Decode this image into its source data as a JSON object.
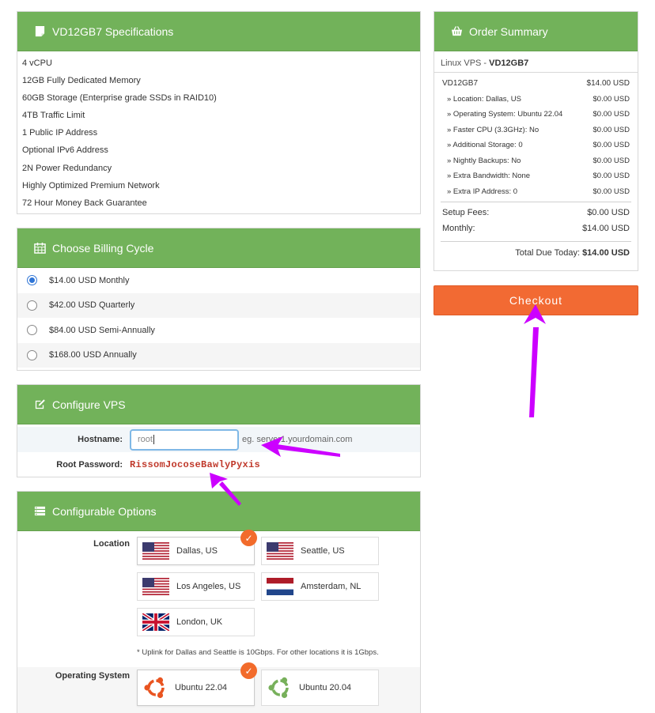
{
  "specs": {
    "title": "VD12GB7 Specifications",
    "items": [
      "4 vCPU",
      "12GB Fully Dedicated Memory",
      "60GB Storage (Enterprise grade SSDs in RAID10)",
      "4TB Traffic Limit",
      "1 Public IP Address",
      "Optional IPv6 Address",
      "2N Power Redundancy",
      "Highly Optimized Premium Network",
      "72 Hour Money Back Guarantee"
    ]
  },
  "billing": {
    "title": "Choose Billing Cycle",
    "options": [
      {
        "label": "$14.00 USD Monthly",
        "selected": true
      },
      {
        "label": "$42.00 USD Quarterly",
        "selected": false
      },
      {
        "label": "$84.00 USD Semi-Annually",
        "selected": false
      },
      {
        "label": "$168.00 USD Annually",
        "selected": false
      }
    ]
  },
  "vps": {
    "title": "Configure VPS",
    "hostname_label": "Hostname:",
    "hostname_value": "root",
    "hostname_hint": "eg. server1.yourdomain.com",
    "password_label": "Root Password:",
    "password_value": "RissomJocoseBawlyPyxis"
  },
  "options": {
    "title": "Configurable Options",
    "location_label": "Location",
    "locations": [
      {
        "name": "Dallas, US",
        "flag": "us",
        "selected": true
      },
      {
        "name": "Seattle, US",
        "flag": "us",
        "selected": false
      },
      {
        "name": "Los Angeles, US",
        "flag": "us",
        "selected": false
      },
      {
        "name": "Amsterdam, NL",
        "flag": "nl",
        "selected": false
      },
      {
        "name": "London, UK",
        "flag": "uk",
        "selected": false
      }
    ],
    "location_note": "* Uplink for Dallas and Seattle is 10Gbps. For other locations it is 1Gbps.",
    "os_label": "Operating System",
    "os": [
      {
        "name": "Ubuntu 22.04",
        "color": "#e95420",
        "selected": true
      },
      {
        "name": "Ubuntu 20.04",
        "color": "#77b05b",
        "selected": false
      }
    ]
  },
  "summary": {
    "title": "Order Summary",
    "product_prefix": "Linux VPS - ",
    "product_name": "VD12GB7",
    "lines": [
      {
        "label": "VD12GB7",
        "value": "$14.00 USD"
      },
      {
        "label": "» Location: Dallas, US",
        "value": "$0.00 USD"
      },
      {
        "label": "» Operating System: Ubuntu 22.04",
        "value": "$0.00 USD"
      },
      {
        "label": "» Faster CPU (3.3GHz): No",
        "value": "$0.00 USD"
      },
      {
        "label": "» Additional Storage: 0",
        "value": "$0.00 USD"
      },
      {
        "label": "» Nightly Backups: No",
        "value": "$0.00 USD"
      },
      {
        "label": "» Extra Bandwidth: None",
        "value": "$0.00 USD"
      },
      {
        "label": "» Extra IP Address: 0",
        "value": "$0.00 USD"
      }
    ],
    "setup_label": "Setup Fees:",
    "setup_value": "$0.00 USD",
    "monthly_label": "Monthly:",
    "monthly_value": "$14.00 USD",
    "total_label": "Total Due Today: ",
    "total_value": "$14.00 USD"
  },
  "checkout_label": "Checkout",
  "colors": {
    "panel_header": "#72b25a",
    "checkout": "#f26a33",
    "annotation_arrow": "#cc00ff"
  }
}
